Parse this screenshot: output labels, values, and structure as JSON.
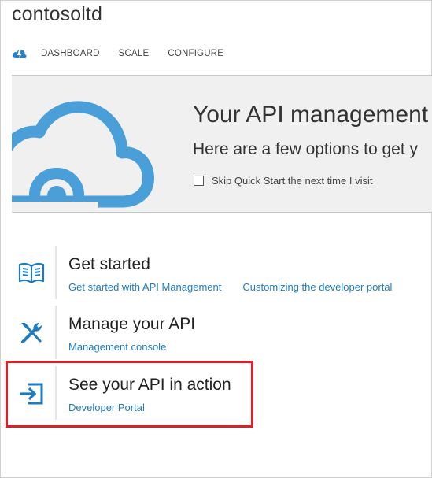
{
  "header": {
    "service_name": "contosoltd",
    "tabs": [
      {
        "label": "DASHBOARD"
      },
      {
        "label": "SCALE"
      },
      {
        "label": "CONFIGURE"
      }
    ],
    "logo_icon": "api-management-cloud-icon"
  },
  "banner": {
    "headline": "Your API management",
    "subheadline": "Here are a few options to get y",
    "skip_checkbox_label": "Skip Quick Start the next time I visit",
    "skip_checked": false,
    "cloud_icon": "cloud-icon"
  },
  "quickstart": [
    {
      "title": "Get started",
      "icon": "book-icon",
      "links": [
        {
          "label": "Get started with API Management"
        },
        {
          "label": "Customizing the developer portal"
        }
      ]
    },
    {
      "title": "Manage your API",
      "icon": "tools-icon",
      "links": [
        {
          "label": "Management console"
        }
      ]
    },
    {
      "title": "See your API in action",
      "icon": "sign-in-icon",
      "links": [
        {
          "label": "Developer Portal"
        }
      ],
      "highlighted": true
    }
  ],
  "colors": {
    "accent_blue": "#1f7bbf",
    "cloud_blue": "#4a9fd8",
    "highlight_red": "#e01f26",
    "banner_bg": "#f0f0f0"
  }
}
